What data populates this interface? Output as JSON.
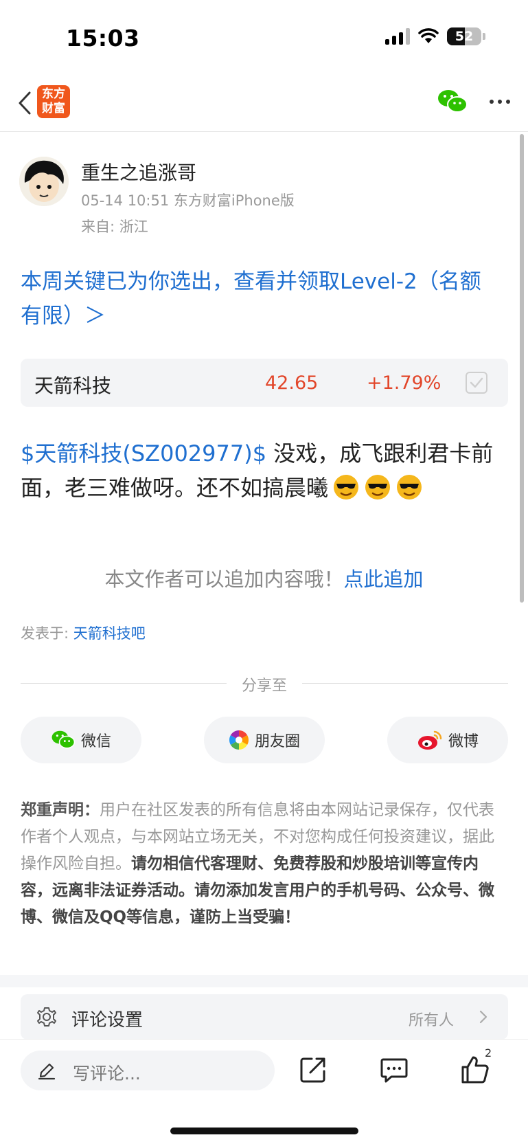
{
  "status_bar": {
    "time": "15:03",
    "battery": "52",
    "battery_level": 0.52
  },
  "nav": {
    "logo_text": "东方财富",
    "back_icon": "chevron-left-icon",
    "share_icon": "wechat-icon",
    "more_icon": "more-icon"
  },
  "post": {
    "author": "重生之追涨哥",
    "meta": "05-14 10:51 东方财富iPhone版",
    "location": "来自: 浙江",
    "promo": "本周关键已为你选出，查看并领取Level-2（名额有限）＞",
    "stock_card": {
      "name": "天箭科技",
      "price": "42.65",
      "change": "+1.79%"
    },
    "stock_link": "$天箭科技(SZ002977)$",
    "body": " 没戏，成飞跟利君卡前面，老三难做呀。还不如搞晨曦",
    "append_text": "本文作者可以追加内容哦！",
    "append_link": "点此追加",
    "posted_in_label": "发表于: ",
    "posted_in_bar": "天箭科技吧"
  },
  "share": {
    "label": "分享至",
    "buttons": [
      {
        "label": "微信",
        "icon": "wechat-icon"
      },
      {
        "label": "朋友圈",
        "icon": "moments-icon"
      },
      {
        "label": "微博",
        "icon": "weibo-icon"
      }
    ]
  },
  "disclaimer": {
    "title": "郑重声明：",
    "normal": "用户在社区发表的所有信息将由本网站记录保存，仅代表作者个人观点，与本网站立场无关，不对您构成任何投资建议，据此操作风险自担。",
    "bold": "请勿相信代客理财、免费荐股和炒股培训等宣传内容，远离非法证券活动。请勿添加发言用户的手机号码、公众号、微博、微信及QQ等信息，谨防上当受骗！"
  },
  "comment_settings": {
    "label": "评论设置",
    "value": "所有人"
  },
  "bottom_bar": {
    "placeholder": "写评论...",
    "like_count": "2"
  },
  "colors": {
    "link": "#1f6fd0",
    "up": "#e2462a",
    "brand": "#f0571c",
    "wechat": "#2dc100"
  }
}
